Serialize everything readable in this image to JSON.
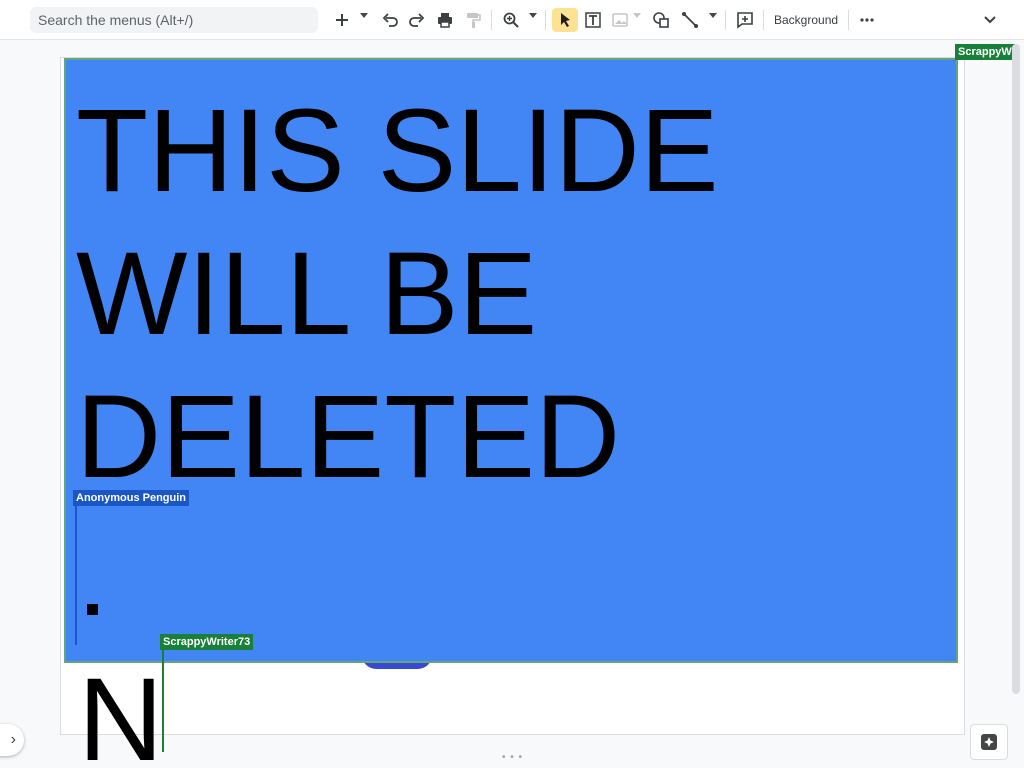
{
  "toolbar": {
    "search_placeholder": "Search the menus (Alt+/)",
    "background_label": "Background",
    "icons": [
      "add-icon",
      "undo-icon",
      "redo-icon",
      "print-icon",
      "paint-format-icon",
      "zoom-icon",
      "select-icon",
      "textbox-icon",
      "image-icon",
      "shape-icon",
      "line-icon",
      "comment-icon",
      "more-icon",
      "collapse-icon"
    ]
  },
  "slide": {
    "lines": [
      "THIS SLIDE",
      "WILL BE",
      "DELETED"
    ],
    "extra_letter": "N",
    "box_color": "#4285f4"
  },
  "collaborators": {
    "top_right": "ScrappyW",
    "penguin": "Anonymous Penguin",
    "scrappy": "ScrappyWriter73"
  },
  "colors": {
    "penguin": "#1a56c4",
    "scrappy": "#188038",
    "accent_select": "#fde293"
  }
}
